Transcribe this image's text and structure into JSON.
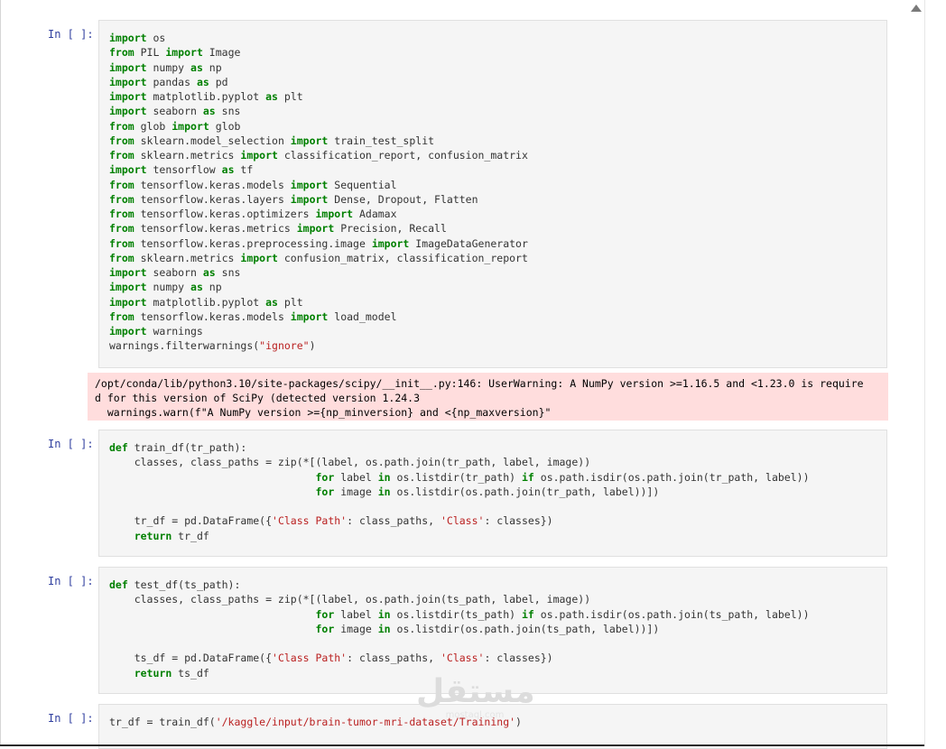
{
  "colors": {
    "prompt": "#303f9f",
    "keyword": "#008000",
    "string": "#ba2121",
    "cell_bg": "#f5f5f5",
    "stderr_bg": "#ffdddd"
  },
  "cells": [
    {
      "prompt": "In [ ]:",
      "code": [
        [
          [
            "kw",
            "import"
          ],
          [
            "t",
            " os"
          ]
        ],
        [
          [
            "kw",
            "from"
          ],
          [
            "t",
            " PIL "
          ],
          [
            "kw",
            "import"
          ],
          [
            "t",
            " Image"
          ]
        ],
        [
          [
            "kw",
            "import"
          ],
          [
            "t",
            " numpy "
          ],
          [
            "kw",
            "as"
          ],
          [
            "t",
            " np"
          ]
        ],
        [
          [
            "kw",
            "import"
          ],
          [
            "t",
            " pandas "
          ],
          [
            "kw",
            "as"
          ],
          [
            "t",
            " pd"
          ]
        ],
        [
          [
            "kw",
            "import"
          ],
          [
            "t",
            " matplotlib.pyplot "
          ],
          [
            "kw",
            "as"
          ],
          [
            "t",
            " plt"
          ]
        ],
        [
          [
            "kw",
            "import"
          ],
          [
            "t",
            " seaborn "
          ],
          [
            "kw",
            "as"
          ],
          [
            "t",
            " sns"
          ]
        ],
        [
          [
            "kw",
            "from"
          ],
          [
            "t",
            " glob "
          ],
          [
            "kw",
            "import"
          ],
          [
            "t",
            " glob"
          ]
        ],
        [
          [
            "kw",
            "from"
          ],
          [
            "t",
            " sklearn.model_selection "
          ],
          [
            "kw",
            "import"
          ],
          [
            "t",
            " train_test_split"
          ]
        ],
        [
          [
            "kw",
            "from"
          ],
          [
            "t",
            " sklearn.metrics "
          ],
          [
            "kw",
            "import"
          ],
          [
            "t",
            " classification_report, confusion_matrix"
          ]
        ],
        [
          [
            "kw",
            "import"
          ],
          [
            "t",
            " tensorflow "
          ],
          [
            "kw",
            "as"
          ],
          [
            "t",
            " tf"
          ]
        ],
        [
          [
            "kw",
            "from"
          ],
          [
            "t",
            " tensorflow.keras.models "
          ],
          [
            "kw",
            "import"
          ],
          [
            "t",
            " Sequential"
          ]
        ],
        [
          [
            "kw",
            "from"
          ],
          [
            "t",
            " tensorflow.keras.layers "
          ],
          [
            "kw",
            "import"
          ],
          [
            "t",
            " Dense, Dropout, Flatten"
          ]
        ],
        [
          [
            "kw",
            "from"
          ],
          [
            "t",
            " tensorflow.keras.optimizers "
          ],
          [
            "kw",
            "import"
          ],
          [
            "t",
            " Adamax"
          ]
        ],
        [
          [
            "kw",
            "from"
          ],
          [
            "t",
            " tensorflow.keras.metrics "
          ],
          [
            "kw",
            "import"
          ],
          [
            "t",
            " Precision, Recall"
          ]
        ],
        [
          [
            "kw",
            "from"
          ],
          [
            "t",
            " tensorflow.keras.preprocessing.image "
          ],
          [
            "kw",
            "import"
          ],
          [
            "t",
            " ImageDataGenerator"
          ]
        ],
        [
          [
            "kw",
            "from"
          ],
          [
            "t",
            " sklearn.metrics "
          ],
          [
            "kw",
            "import"
          ],
          [
            "t",
            " confusion_matrix, classification_report"
          ]
        ],
        [
          [
            "kw",
            "import"
          ],
          [
            "t",
            " seaborn "
          ],
          [
            "kw",
            "as"
          ],
          [
            "t",
            " sns"
          ]
        ],
        [
          [
            "kw",
            "import"
          ],
          [
            "t",
            " numpy "
          ],
          [
            "kw",
            "as"
          ],
          [
            "t",
            " np"
          ]
        ],
        [
          [
            "kw",
            "import"
          ],
          [
            "t",
            " matplotlib.pyplot "
          ],
          [
            "kw",
            "as"
          ],
          [
            "t",
            " plt"
          ]
        ],
        [
          [
            "kw",
            "from"
          ],
          [
            "t",
            " tensorflow.keras.models "
          ],
          [
            "kw",
            "import"
          ],
          [
            "t",
            " load_model"
          ]
        ],
        [
          [
            "kw",
            "import"
          ],
          [
            "t",
            " warnings"
          ]
        ],
        [
          [
            "t",
            "warnings.filterwarnings("
          ],
          [
            "str",
            "\"ignore\""
          ],
          [
            "t",
            ")"
          ]
        ]
      ]
    },
    {
      "prompt": "In [ ]:",
      "code": [
        [
          [
            "kw",
            "def"
          ],
          [
            "t",
            " train_df(tr_path):"
          ]
        ],
        [
          [
            "t",
            "    classes, class_paths = zip(*[(label, os.path.join(tr_path, label, image))"
          ]
        ],
        [
          [
            "t",
            "                                 "
          ],
          [
            "kw",
            "for"
          ],
          [
            "t",
            " label "
          ],
          [
            "kw",
            "in"
          ],
          [
            "t",
            " os.listdir(tr_path) "
          ],
          [
            "kw",
            "if"
          ],
          [
            "t",
            " os.path.isdir(os.path.join(tr_path, label))"
          ]
        ],
        [
          [
            "t",
            "                                 "
          ],
          [
            "kw",
            "for"
          ],
          [
            "t",
            " image "
          ],
          [
            "kw",
            "in"
          ],
          [
            "t",
            " os.listdir(os.path.join(tr_path, label))])"
          ]
        ],
        [
          [
            "t",
            ""
          ]
        ],
        [
          [
            "t",
            "    tr_df = pd.DataFrame({"
          ],
          [
            "str",
            "'Class Path'"
          ],
          [
            "t",
            ": class_paths, "
          ],
          [
            "str",
            "'Class'"
          ],
          [
            "t",
            ": classes})"
          ]
        ],
        [
          [
            "t",
            "    "
          ],
          [
            "kw",
            "return"
          ],
          [
            "t",
            " tr_df"
          ]
        ]
      ]
    },
    {
      "prompt": "In [ ]:",
      "code": [
        [
          [
            "kw",
            "def"
          ],
          [
            "t",
            " test_df(ts_path):"
          ]
        ],
        [
          [
            "t",
            "    classes, class_paths = zip(*[(label, os.path.join(ts_path, label, image))"
          ]
        ],
        [
          [
            "t",
            "                                 "
          ],
          [
            "kw",
            "for"
          ],
          [
            "t",
            " label "
          ],
          [
            "kw",
            "in"
          ],
          [
            "t",
            " os.listdir(ts_path) "
          ],
          [
            "kw",
            "if"
          ],
          [
            "t",
            " os.path.isdir(os.path.join(ts_path, label))"
          ]
        ],
        [
          [
            "t",
            "                                 "
          ],
          [
            "kw",
            "for"
          ],
          [
            "t",
            " image "
          ],
          [
            "kw",
            "in"
          ],
          [
            "t",
            " os.listdir(os.path.join(ts_path, label))])"
          ]
        ],
        [
          [
            "t",
            ""
          ]
        ],
        [
          [
            "t",
            "    ts_df = pd.DataFrame({"
          ],
          [
            "str",
            "'Class Path'"
          ],
          [
            "t",
            ": class_paths, "
          ],
          [
            "str",
            "'Class'"
          ],
          [
            "t",
            ": classes})"
          ]
        ],
        [
          [
            "t",
            "    "
          ],
          [
            "kw",
            "return"
          ],
          [
            "t",
            " ts_df"
          ]
        ]
      ]
    },
    {
      "prompt": "In [ ]:",
      "code": [
        [
          [
            "t",
            "tr_df = train_df("
          ],
          [
            "str",
            "'/kaggle/input/brain-tumor-mri-dataset/Training'"
          ],
          [
            "t",
            ")"
          ]
        ]
      ]
    }
  ],
  "stderr_output": {
    "lines": [
      "/opt/conda/lib/python3.10/site-packages/scipy/__init__.py:146: UserWarning: A NumPy version >=1.16.5 and <1.23.0 is require",
      "d for this version of SciPy (detected version 1.24.3",
      "  warnings.warn(f\"A NumPy version >={np_minversion} and <{np_maxversion}\""
    ]
  },
  "watermark": {
    "main": "مستقل",
    "sub": "mostaql.com"
  },
  "icons": {
    "scroll_up": "scroll-up-arrow-icon"
  }
}
